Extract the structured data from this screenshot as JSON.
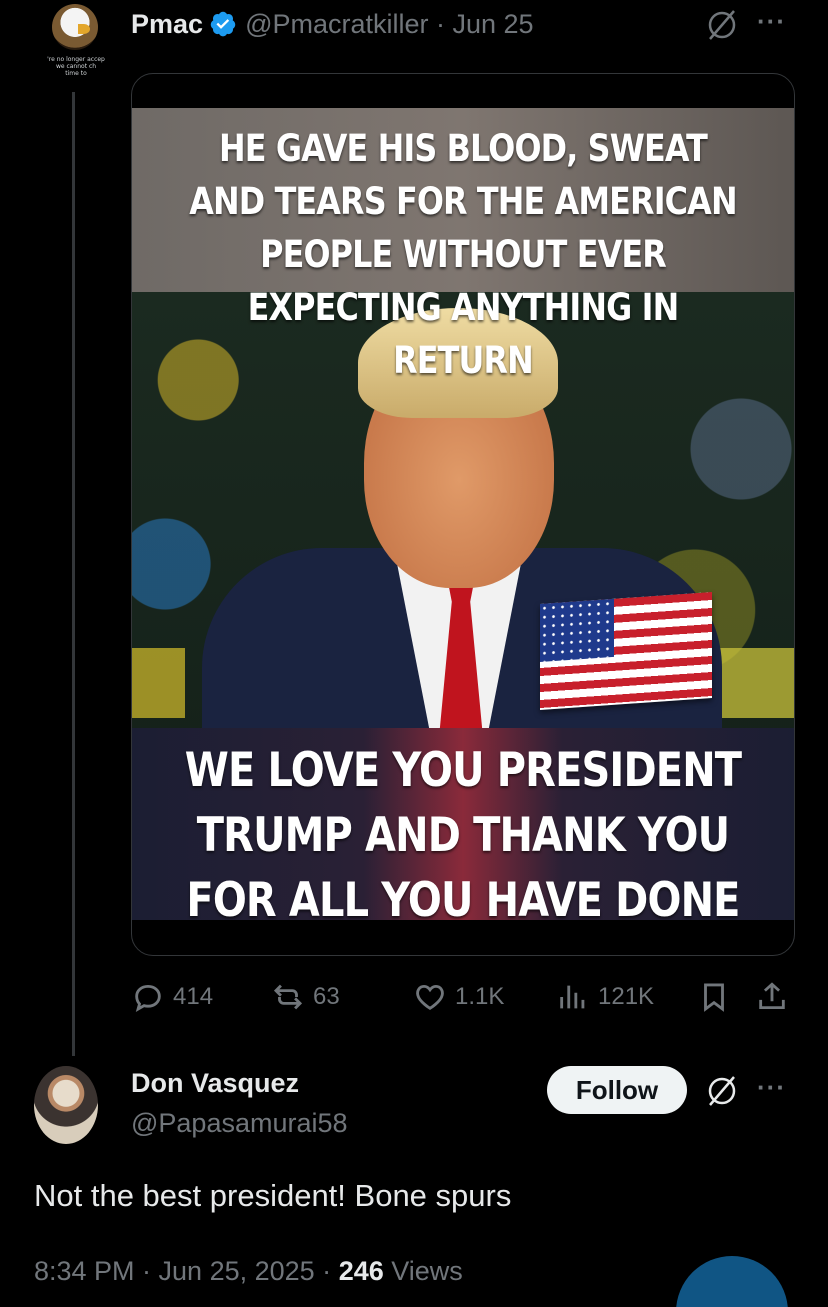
{
  "tweet": {
    "name": "Pmac",
    "handle": "@Pmacratkiller",
    "date": "· Jun 25",
    "avatar_caption": "'re no longer accep\nwe cannot ch\ntime to",
    "image_top_text": "HE GAVE HIS BLOOD, SWEAT AND TEARS FOR THE AMERICAN PEOPLE WITHOUT EVER EXPECTING ANYTHING IN RETURN",
    "image_bottom_text": "WE LOVE YOU PRESIDENT TRUMP AND THANK YOU FOR ALL YOU HAVE DONE",
    "stats": {
      "replies": "414",
      "reposts": "63",
      "likes": "1.1K",
      "views": "121K"
    }
  },
  "reply": {
    "name": "Don Vasquez",
    "handle": "@Papasamurai58",
    "follow_label": "Follow",
    "text": "Not the best president! Bone spurs",
    "time": "8:34 PM · Jun 25, 2025 · ",
    "views_count": "246",
    "views_label": " Views"
  },
  "colors": {
    "background": "#000000",
    "verified": "#1d9bf0",
    "muted": "#71767b",
    "text": "#e7e9ea"
  },
  "icons": [
    "grok-icon",
    "more-icon",
    "reply-icon",
    "repost-icon",
    "like-icon",
    "views-icon",
    "bookmark-icon",
    "share-icon",
    "verified-icon"
  ]
}
